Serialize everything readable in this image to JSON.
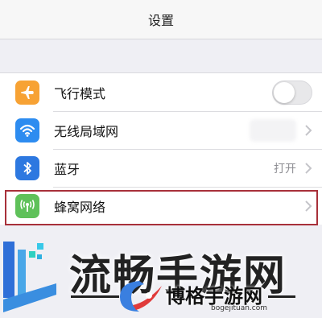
{
  "navbar": {
    "title": "设置"
  },
  "settings": {
    "items": [
      {
        "label": "飞行模式",
        "icon": "airplane-icon",
        "color": "#f7a234",
        "accessory": "toggle",
        "value": "",
        "toggle_on": false
      },
      {
        "label": "无线局域网",
        "icon": "wifi-icon",
        "color": "#2d8cf0",
        "accessory": "chevron",
        "value": ""
      },
      {
        "label": "蓝牙",
        "icon": "bluetooth-icon",
        "color": "#2d78e0",
        "accessory": "chevron",
        "value": "打开"
      },
      {
        "label": "蜂窝网络",
        "icon": "cellular-icon",
        "color": "#5fc15a",
        "accessory": "chevron",
        "value": ""
      }
    ]
  },
  "watermark": {
    "headline": "流畅手游网",
    "brand_name": "博格手游网",
    "domain": "bogejituan.com"
  },
  "colors": {
    "highlight_border": "#a8303a",
    "background": "#efeff4"
  }
}
